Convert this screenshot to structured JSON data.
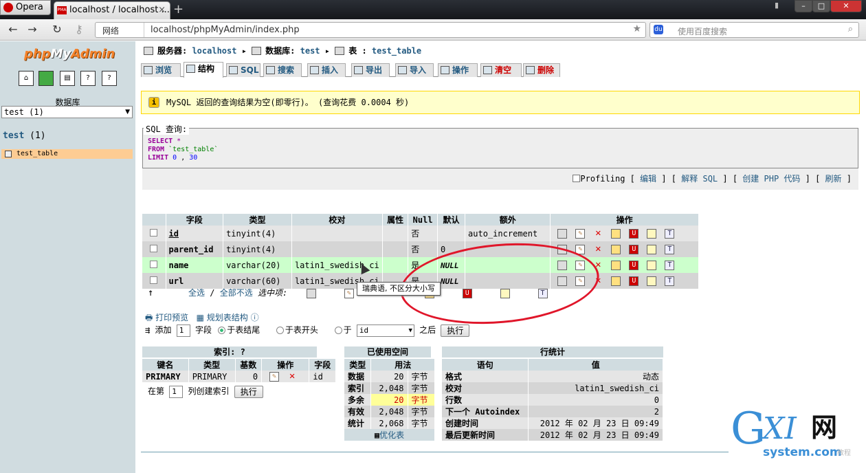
{
  "browser": {
    "app_name": "Opera",
    "tab_title": "localhost / localhost ...",
    "tab_favicon": "PMA",
    "new_tab": "+",
    "url_scheme": "网络",
    "url": "localhost/phpMyAdmin/index.php",
    "search_placeholder": "使用百度搜索"
  },
  "left": {
    "logo_a": "php",
    "logo_b": "My",
    "logo_c": "Admin",
    "db_label": "数据库",
    "db_selected": "test (1)",
    "db_link": "test",
    "db_count": "(1)",
    "table_item": "test_table"
  },
  "crumb": {
    "server_label": "服务器: ",
    "server": "localhost",
    "db_label": "数据库: ",
    "db": "test",
    "table_label": "表 : ",
    "table": "test_table"
  },
  "tabs": [
    "浏览",
    "结构",
    "SQL",
    "搜索",
    "插入",
    "导出",
    "导入",
    "操作",
    "清空",
    "删除"
  ],
  "notice": "MySQL 返回的查询结果为空(即零行)。 (查询花费 0.0004 秒)",
  "sql": {
    "legend": "SQL 查询:",
    "select": "SELECT",
    "star": "*",
    "from": "FROM",
    "table": "`test_table`",
    "limit": "LIMIT",
    "l1": "0",
    "comma": ",",
    "l2": "30",
    "profiling": "Profiling",
    "edit": "编辑",
    "explain": "解释 SQL",
    "php": "创建 PHP 代码",
    "refresh": "刷新"
  },
  "fields": {
    "headers": [
      "字段",
      "类型",
      "校对",
      "属性",
      "Null",
      "默认",
      "额外",
      "操作"
    ],
    "rows": [
      {
        "name": "id",
        "type": "tinyint(4)",
        "collation": "",
        "attr": "",
        "null": "否",
        "default": "",
        "extra": "auto_increment"
      },
      {
        "name": "parent_id",
        "type": "tinyint(4)",
        "collation": "",
        "attr": "",
        "null": "否",
        "default": "0",
        "extra": ""
      },
      {
        "name": "name",
        "type": "varchar(20)",
        "collation": "latin1_swedish_ci",
        "attr": "",
        "null": "是",
        "default": "NULL",
        "extra": ""
      },
      {
        "name": "url",
        "type": "varchar(60)",
        "collation": "latin1_swedish_ci",
        "attr": "",
        "null": "是",
        "default": "NULL",
        "extra": ""
      }
    ],
    "select_all": "全选",
    "slash": "/",
    "deselect_all": "全部不选",
    "with_selected": "选中项:",
    "tooltip": "瑞典语, 不区分大小写"
  },
  "tools": {
    "print": "打印预览",
    "plan": "规划表结构",
    "add": "添加",
    "add_count": "1",
    "fields_word": "字段",
    "at_end": "于表结尾",
    "at_begin": "于表开头",
    "after_word": "于",
    "after_field": "id",
    "after_suffix": "之后",
    "go": "执行"
  },
  "indexes": {
    "caption": "索引:",
    "help": "?",
    "headers": [
      "键名",
      "类型",
      "基数",
      "操作",
      "字段"
    ],
    "row": {
      "key": "PRIMARY",
      "type": "PRIMARY",
      "card": "0",
      "field": "id"
    },
    "create_pre": "在第",
    "create_count": "1",
    "create_post": "列创建索引",
    "create_go": "执行"
  },
  "space": {
    "caption": "已使用空间",
    "headers": [
      "类型",
      "用法"
    ],
    "rows": [
      {
        "label": "数据",
        "value": "20",
        "unit": "字节"
      },
      {
        "label": "索引",
        "value": "2,048",
        "unit": "字节"
      },
      {
        "label": "多余",
        "value": "20",
        "unit": "字节"
      },
      {
        "label": "有效",
        "value": "2,048",
        "unit": "字节"
      },
      {
        "label": "统计",
        "value": "2,068",
        "unit": "字节"
      }
    ],
    "optimize": "优化表"
  },
  "rowstats": {
    "caption": "行统计",
    "headers": [
      "语句",
      "值"
    ],
    "rows": [
      {
        "label": "格式",
        "value": "动态"
      },
      {
        "label": "校对",
        "value": "latin1_swedish_ci"
      },
      {
        "label": "行数",
        "value": "0"
      },
      {
        "label": "下一个 Autoindex",
        "value": "2"
      },
      {
        "label": "创建时间",
        "value": "2012 年 02 月 23 日 09:49"
      },
      {
        "label": "最后更新时间",
        "value": "2012 年 02 月 23 日 09:49"
      }
    ]
  },
  "watermark": {
    "g": "G",
    "xi": "XI",
    "wang": "网",
    "sys": "system.com",
    "jc": "教程"
  },
  "colors": {
    "accent": "#235a81",
    "header": "#d0dce0",
    "notice": "#ffffcc",
    "annotation": "#e0162a"
  }
}
